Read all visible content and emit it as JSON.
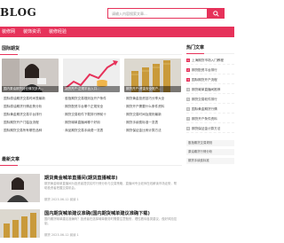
{
  "header": {
    "logo": "BLOG",
    "search_placeholder": "请输入内容搜索文章..."
  },
  "nav": {
    "items": [
      "装修网",
      "装饰资讯",
      "装修经验"
    ]
  },
  "featured": {
    "title": "国际期货",
    "cards": [
      {
        "caption": "国内原油期货持仓情况多大..."
      },
      {
        "caption": "期货开户·正规平台入口..."
      },
      {
        "caption": "期货开户·资金安全账户..."
      }
    ],
    "list_left": [
      "国际原油期货交易时间表最新",
      "国际原油期货行情走势分析",
      "国际黄金期货交易平台排行",
      "国际期货开户门槛及流程",
      "国际期货交易所有哪些品种"
    ],
    "list_mid": [
      "股指期货交易规则及开户条件",
      "期货配资平台哪个正规安全",
      "期货交易软件下载排行榜前十",
      "期货喊单直播间哪个好用",
      "商品期货交易手续费一览表"
    ],
    "list_right": [
      "期货黄金投资技巧分享大全",
      "期货开户需要什么条件资料",
      "期货交易时间及规则最新",
      "期货手续费标准一览表",
      "期货保证金比例计算方法"
    ]
  },
  "latest": {
    "title": "最新文章",
    "articles": [
      {
        "title": "期货黄金喊单直播间(期货直播喊单)",
        "desc": "期货黄金喊单直播间为投资者提供实时行情分析与交易策略，直播间专业老师在线解读市场走势，帮助投资者把握交易机会。",
        "meta": "期货   2023-06-12   阅读 1"
      },
      {
        "title": "国内期货喊单建议准确(国内期货喊单建议准确下载)",
        "desc": "国内期货喊单建议准确吗？投资者在选择喊单服务时需要注意甄别，理性看待各类建议，做好风险控制。",
        "meta": "期货   2023-06-12   阅读 1"
      }
    ]
  },
  "sidebar": {
    "hot_title": "热门文章",
    "hot_items": [
      "上海期货市场入门教程",
      "期货配资平台排行",
      "国际期货开户流程",
      "期货喊单直播间推荐",
      "期货交易软件排行",
      "国际黄金期货行情",
      "期货开户条件资料",
      "期货保证金计算方法"
    ],
    "boxes": [
      "股指期货交易规则",
      "原油期货行情分析",
      "期货手续费标准"
    ]
  },
  "colors": {
    "accent": "#e6325a"
  }
}
